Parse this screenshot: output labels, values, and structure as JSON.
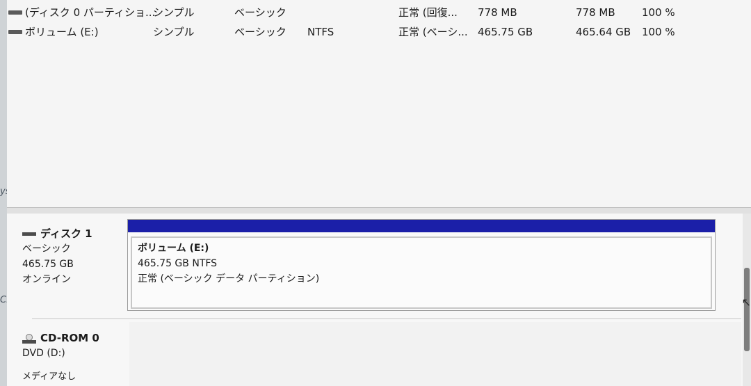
{
  "desktop": {
    "cut_labels": [
      "ysi",
      "Cryst"
    ]
  },
  "volumes": {
    "rows": [
      {
        "name": "(ディスク 0 パーティショ...",
        "layout": "シンプル",
        "type": "ベーシック",
        "fs": "",
        "status": "正常 (回復...",
        "capacity": "778 MB",
        "free": "778 MB",
        "pct": "100 %"
      },
      {
        "name": "ボリューム (E:)",
        "layout": "シンプル",
        "type": "ベーシック",
        "fs": "NTFS",
        "status": "正常 (ベーシ...",
        "capacity": "465.75 GB",
        "free": "465.64 GB",
        "pct": "100 %"
      }
    ]
  },
  "disks": {
    "disk1": {
      "name": "ディスク 1",
      "type": "ベーシック",
      "size": "465.75 GB",
      "state": "オンライン",
      "partition": {
        "title": "ボリューム  (E:)",
        "size_fs": "465.75 GB NTFS",
        "status": "正常 (ベーシック データ パーティション)",
        "bar_color": "#1b1fa8"
      }
    },
    "cdrom0": {
      "name": "CD-ROM 0",
      "drive": "DVD (D:)",
      "media": "メディアなし"
    }
  },
  "cursor_glyph": "↖"
}
